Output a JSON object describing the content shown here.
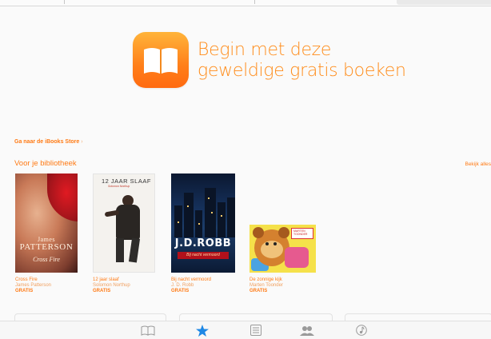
{
  "hero": {
    "title_line1": "Begin met deze",
    "title_line2": "geweldige gratis boeken"
  },
  "store_link": "Ga naar de iBooks Store",
  "section": {
    "title": "Voor je bibliotheek",
    "see_all": "Bekijk alles"
  },
  "books": [
    {
      "title": "Cross Fire",
      "author": "James Patterson",
      "price": "GRATIS",
      "cover_line1": "James",
      "cover_line2": "PATTERSON",
      "cover_line3": "Cross Fire"
    },
    {
      "title": "12 jaar slaaf",
      "author": "Solomon Northup",
      "price": "GRATIS",
      "cover_title": "12 JAAR SLAAF",
      "cover_sub": "Solomon Northup"
    },
    {
      "title": "Bij nacht vermoord",
      "author": "J. D. Robb",
      "price": "GRATIS",
      "cover_name": "J.D.ROBB",
      "cover_sub": "Bij nacht vermoord"
    },
    {
      "title": "De zonnige kijk",
      "author": "Marten Toonder",
      "price": "GRATIS",
      "cover_badge": "MARTEN TOONDER"
    }
  ],
  "tabbar": {
    "items": [
      "book-open-icon",
      "star-icon",
      "list-icon",
      "people-icon",
      "music-note-icon"
    ],
    "active": "star-icon",
    "accent": "#1e88e5"
  },
  "colors": {
    "accent": "#ff7a14",
    "icon_gradient_top": "#ffb43a",
    "icon_gradient_bottom": "#ff6a10"
  }
}
